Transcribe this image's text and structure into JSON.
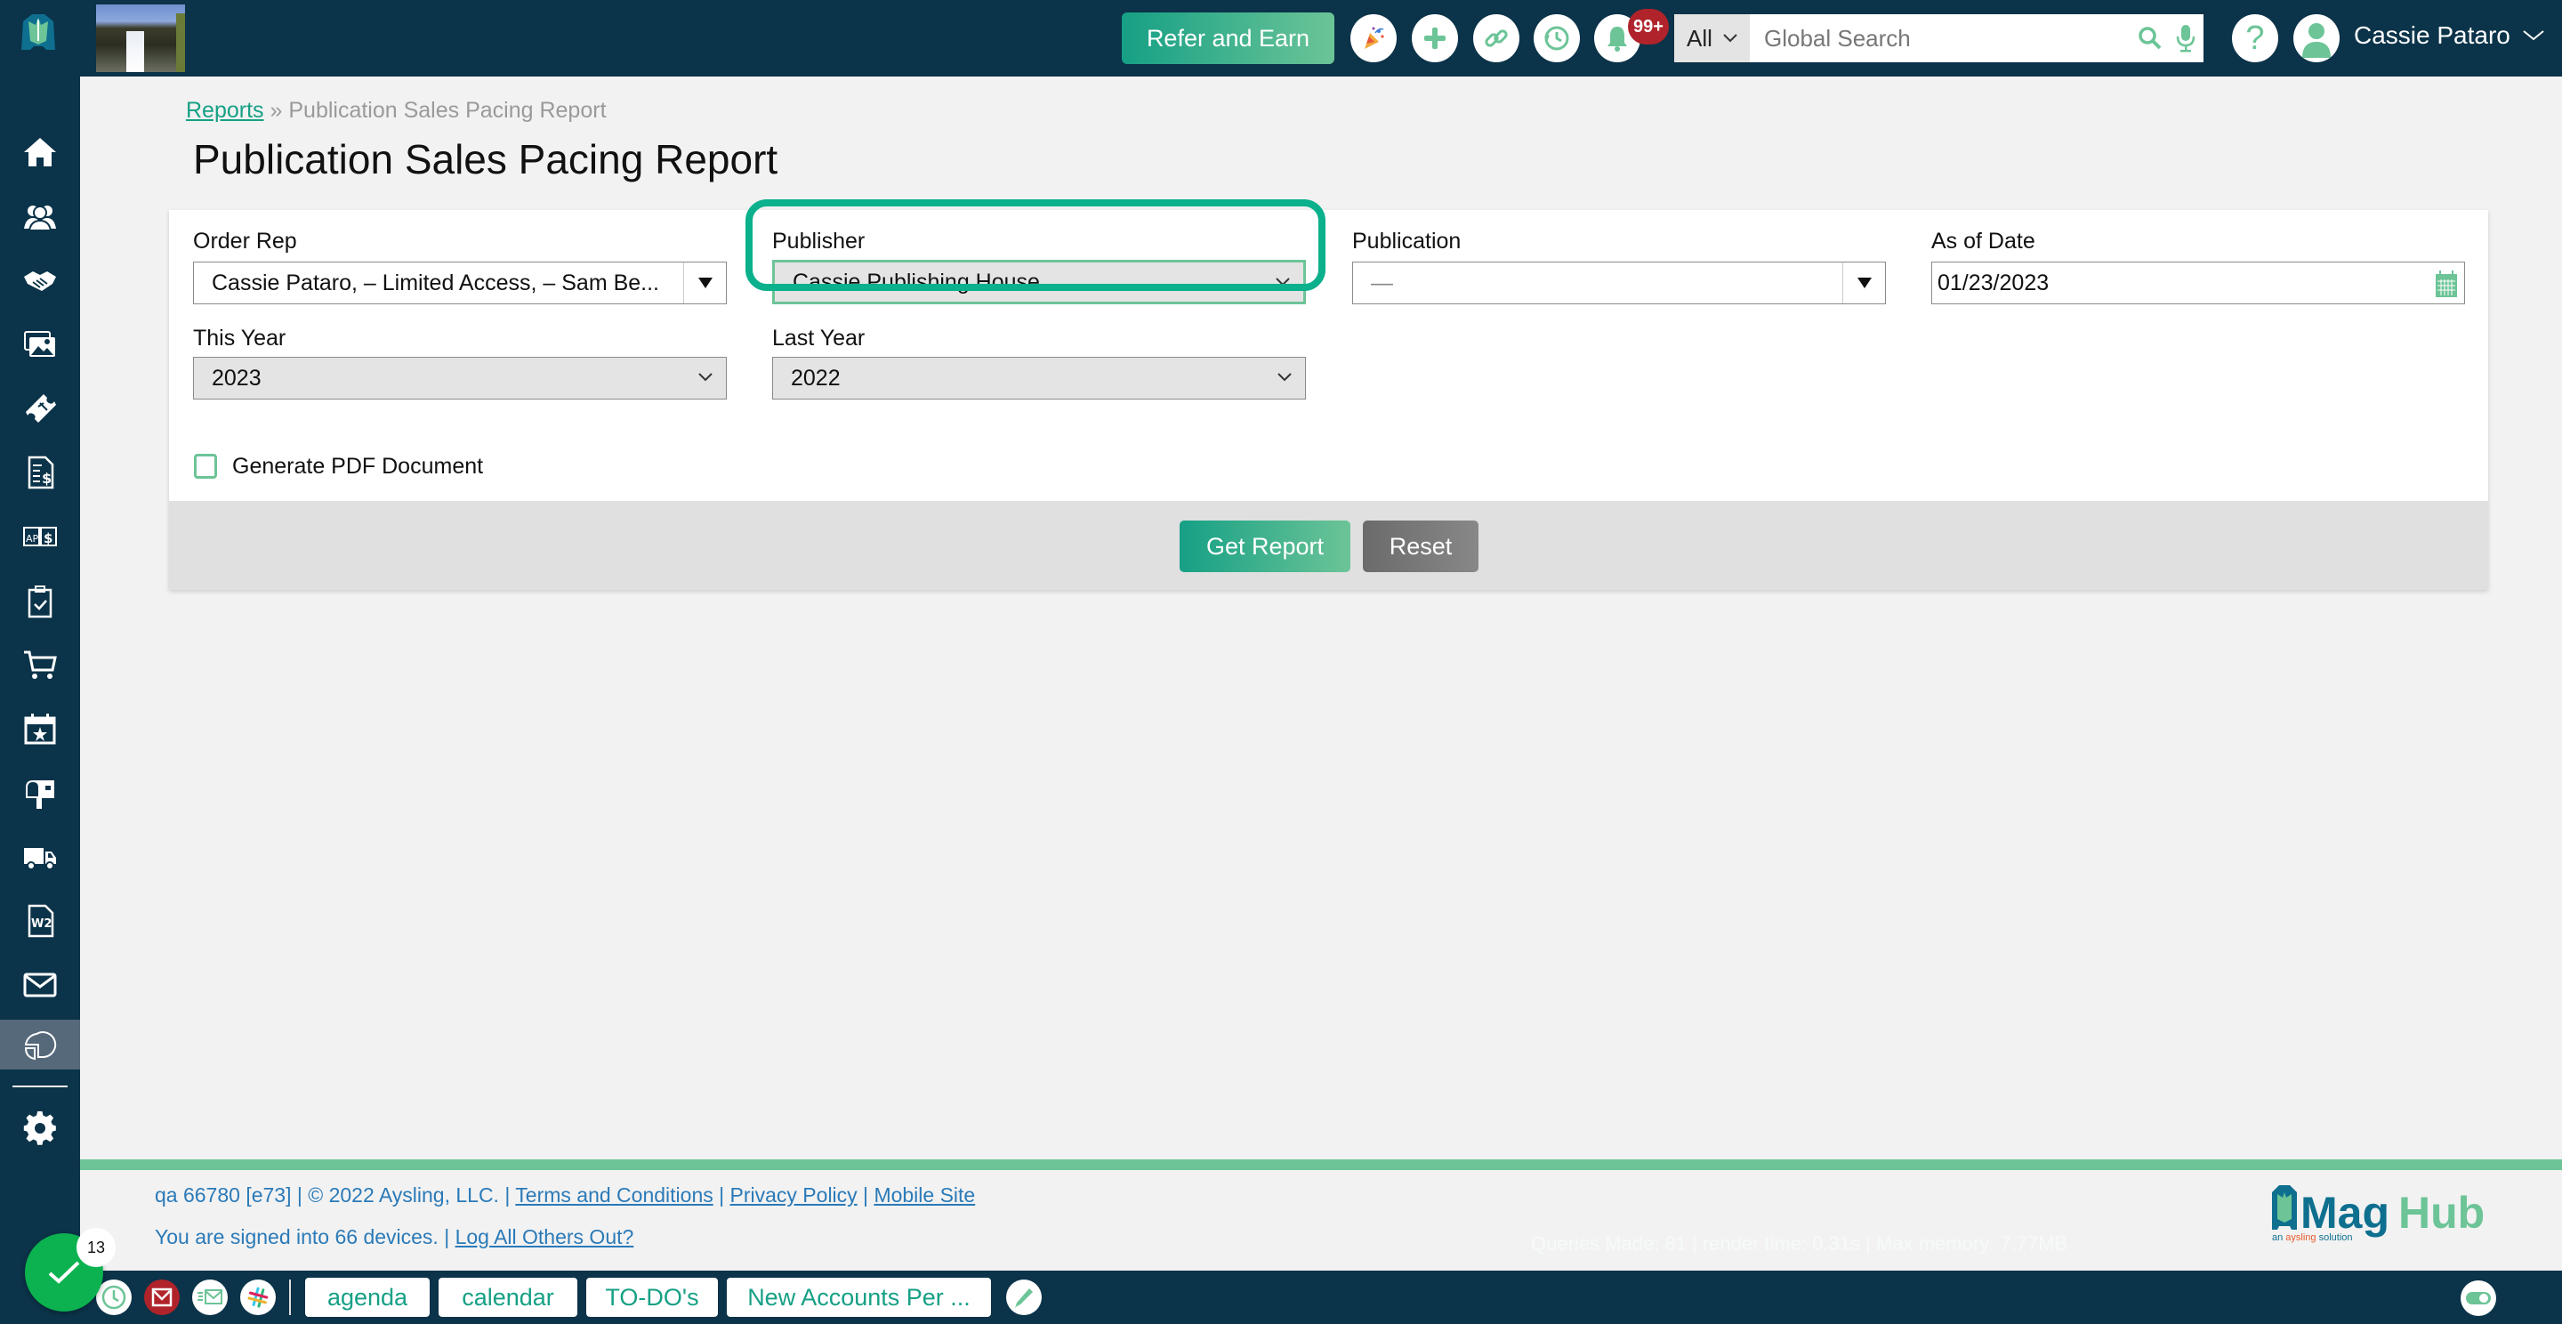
{
  "header": {
    "refer_button": "Refer and Earn",
    "icons": [
      "party-popper-icon",
      "plus-icon",
      "link-icon",
      "history-icon",
      "bell-icon"
    ],
    "notification_count": "99+",
    "search": {
      "scope": "All",
      "placeholder": "Global Search"
    },
    "help_label": "?",
    "user_name": "Cassie Pataro"
  },
  "sidebar": {
    "items": [
      {
        "name": "home",
        "icon": "home-icon"
      },
      {
        "name": "contacts",
        "icon": "people-icon"
      },
      {
        "name": "deals",
        "icon": "handshake-icon"
      },
      {
        "name": "media",
        "icon": "images-icon"
      },
      {
        "name": "tickets",
        "icon": "ticket-icon"
      },
      {
        "name": "billing",
        "icon": "invoice-dollar-icon"
      },
      {
        "name": "accounts-payable",
        "icon": "ap-dollar-icon"
      },
      {
        "name": "tasks",
        "icon": "clipboard-check-icon"
      },
      {
        "name": "orders",
        "icon": "cart-icon"
      },
      {
        "name": "events",
        "icon": "calendar-star-icon"
      },
      {
        "name": "mail",
        "icon": "mailbox-icon"
      },
      {
        "name": "shipping",
        "icon": "truck-icon"
      },
      {
        "name": "w2",
        "icon": "w2-form-icon"
      },
      {
        "name": "email",
        "icon": "envelope-icon"
      },
      {
        "name": "reports",
        "icon": "pie-chart-icon",
        "active": true
      },
      {
        "name": "settings",
        "icon": "gear-icon"
      }
    ]
  },
  "breadcrumb": {
    "parent": "Reports",
    "separator": "»",
    "current": "Publication Sales Pacing Report"
  },
  "page_title": "Publication Sales Pacing Report",
  "form": {
    "order_rep": {
      "label": "Order Rep",
      "value": "Cassie Pataro, – Limited Access, – Sam Be..."
    },
    "publisher": {
      "label": "Publisher",
      "value": "Cassie Publishing House"
    },
    "publication": {
      "label": "Publication",
      "value": "—"
    },
    "as_of_date": {
      "label": "As of Date",
      "value": "01/23/2023"
    },
    "this_year": {
      "label": "This Year",
      "value": "2023"
    },
    "last_year": {
      "label": "Last Year",
      "value": "2022"
    },
    "generate_pdf": {
      "label": "Generate PDF Document",
      "checked": false
    },
    "get_report_button": "Get Report",
    "reset_button": "Reset"
  },
  "footer": {
    "build": "qa 66780 [e73] | © 2022 Aysling, LLC. |",
    "links": [
      "Terms and Conditions",
      "Privacy Policy",
      "Mobile Site"
    ],
    "signed_in_text": "You are signed into 66 devices. |",
    "logout_others_link": "Log All Others Out?",
    "perf": "Queries Made: 81 | render time: 0.31s | Max memory: 7.77MB",
    "logo_text_1": "Mag",
    "logo_text_2": "Hub",
    "logo_tagline_pre": "an ",
    "logo_tagline_brand": "aysling",
    "logo_tagline_post": " solution"
  },
  "bottombar": {
    "fab_badge": "13",
    "tabs": [
      "agenda",
      "calendar",
      "TO-DO's",
      "New Accounts Per ..."
    ]
  },
  "colors": {
    "navy": "#0b3349",
    "accent_green": "#16a085",
    "light_green": "#6cc497",
    "highlight": "#0bb08c",
    "badge_red": "#b0232a",
    "link_blue": "#2a7ab8"
  }
}
